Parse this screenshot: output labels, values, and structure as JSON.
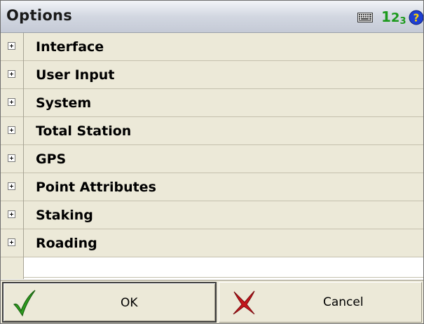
{
  "window": {
    "title": "Options",
    "icons": [
      "keyboard-icon",
      "numeric-input-icon",
      "help-icon"
    ],
    "numeric_indicator": {
      "one": "1",
      "two": "2",
      "three": "3"
    }
  },
  "tree": {
    "items": [
      {
        "label": "Interface",
        "expander": "+"
      },
      {
        "label": "User Input",
        "expander": "+"
      },
      {
        "label": "System",
        "expander": "+"
      },
      {
        "label": "Total Station",
        "expander": "+"
      },
      {
        "label": "GPS",
        "expander": "+"
      },
      {
        "label": "Point Attributes",
        "expander": "+"
      },
      {
        "label": "Staking",
        "expander": "+"
      },
      {
        "label": "Roading",
        "expander": "+"
      }
    ]
  },
  "buttons": {
    "ok_label": "OK",
    "cancel_label": "Cancel"
  },
  "colors": {
    "panel": "#ece9d8",
    "ok_check": "#2e9e1f",
    "cancel_x": "#c4161c",
    "numeric_green": "#1c9a1c",
    "help_blue": "#1f3fd1"
  }
}
